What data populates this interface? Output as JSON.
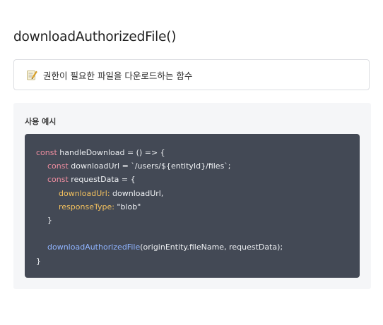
{
  "page": {
    "title": "downloadAuthorizedFile()"
  },
  "description": {
    "icon": "memo-icon",
    "text": "권한이 필요한 파일을 다운로드하는 함수"
  },
  "usage": {
    "title": "사용 예시",
    "code": {
      "line1": {
        "kw": "const",
        "rest": " handleDownload = () => {"
      },
      "line2": {
        "kw": "const",
        "rest": " downloadUrl = `/users/${entityId}/files`;"
      },
      "line3": {
        "kw": "const",
        "rest": " requestData = {"
      },
      "line4": {
        "prop": "downloadUrl:",
        "rest": " downloadUrl,"
      },
      "line5": {
        "prop": "responseType:",
        "rest": " \"blob\""
      },
      "line6": {
        "rest": "}"
      },
      "line7": {
        "rest": ""
      },
      "line8": {
        "fn": "downloadAuthorizedFile",
        "rest": "(originEntity.fileName, requestData);"
      },
      "line9": {
        "rest": "}"
      }
    }
  }
}
